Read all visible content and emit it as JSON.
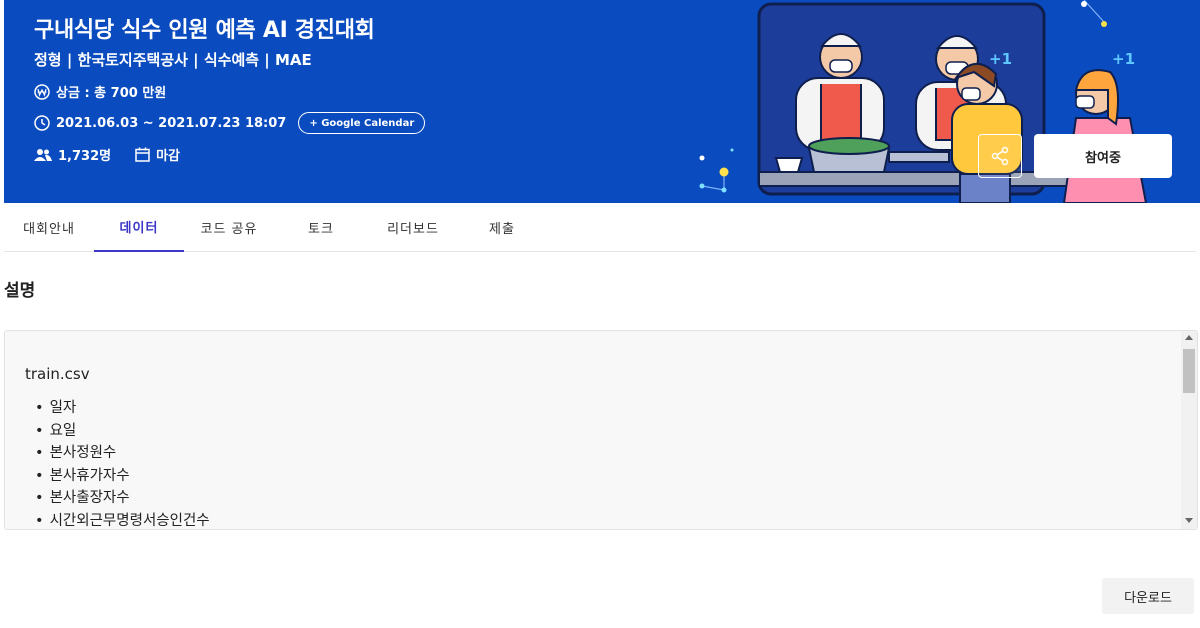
{
  "banner": {
    "title": "구내식당 식수 인원 예측 AI 경진대회",
    "subtitle": "정형 | 한국토지주택공사 | 식수예측 | MAE",
    "prize": "상금 : 총 700 만원",
    "date_range": "2021.06.03 ~ 2021.07.23 18:07",
    "google_calendar_label": "+ Google Calendar",
    "participants": "1,732명",
    "status": "마감",
    "join_label": "참여중",
    "plus_marks": [
      "+1",
      "+1"
    ],
    "colors": {
      "background": "#0a4cbf",
      "accent": "#3c37c6"
    },
    "icons": [
      "won-icon",
      "clock-icon",
      "people-icon",
      "calendar-icon",
      "share-icon"
    ]
  },
  "tabs": [
    {
      "label": "대회안내",
      "active": false
    },
    {
      "label": "데이터",
      "active": true
    },
    {
      "label": "코드 공유",
      "active": false
    },
    {
      "label": "토크",
      "active": false
    },
    {
      "label": "리더보드",
      "active": false
    },
    {
      "label": "제출",
      "active": false
    }
  ],
  "section": {
    "title": "설명"
  },
  "description": {
    "file_name": "train.csv",
    "columns": [
      "일자",
      "요일",
      "본사정원수",
      "본사휴가자수",
      "본사출장자수",
      "시간외근무명령서승인건수"
    ]
  },
  "download_label": "다운로드"
}
